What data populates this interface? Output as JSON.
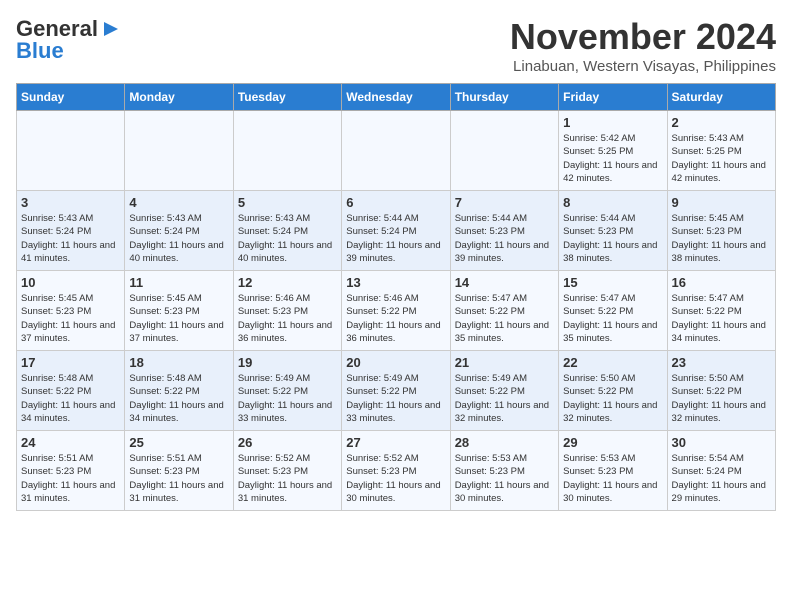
{
  "logo": {
    "text1": "General",
    "text2": "Blue"
  },
  "title": "November 2024",
  "location": "Linabuan, Western Visayas, Philippines",
  "weekdays": [
    "Sunday",
    "Monday",
    "Tuesday",
    "Wednesday",
    "Thursday",
    "Friday",
    "Saturday"
  ],
  "rows": [
    [
      {
        "day": "",
        "info": ""
      },
      {
        "day": "",
        "info": ""
      },
      {
        "day": "",
        "info": ""
      },
      {
        "day": "",
        "info": ""
      },
      {
        "day": "",
        "info": ""
      },
      {
        "day": "1",
        "info": "Sunrise: 5:42 AM\nSunset: 5:25 PM\nDaylight: 11 hours and 42 minutes."
      },
      {
        "day": "2",
        "info": "Sunrise: 5:43 AM\nSunset: 5:25 PM\nDaylight: 11 hours and 42 minutes."
      }
    ],
    [
      {
        "day": "3",
        "info": "Sunrise: 5:43 AM\nSunset: 5:24 PM\nDaylight: 11 hours and 41 minutes."
      },
      {
        "day": "4",
        "info": "Sunrise: 5:43 AM\nSunset: 5:24 PM\nDaylight: 11 hours and 40 minutes."
      },
      {
        "day": "5",
        "info": "Sunrise: 5:43 AM\nSunset: 5:24 PM\nDaylight: 11 hours and 40 minutes."
      },
      {
        "day": "6",
        "info": "Sunrise: 5:44 AM\nSunset: 5:24 PM\nDaylight: 11 hours and 39 minutes."
      },
      {
        "day": "7",
        "info": "Sunrise: 5:44 AM\nSunset: 5:23 PM\nDaylight: 11 hours and 39 minutes."
      },
      {
        "day": "8",
        "info": "Sunrise: 5:44 AM\nSunset: 5:23 PM\nDaylight: 11 hours and 38 minutes."
      },
      {
        "day": "9",
        "info": "Sunrise: 5:45 AM\nSunset: 5:23 PM\nDaylight: 11 hours and 38 minutes."
      }
    ],
    [
      {
        "day": "10",
        "info": "Sunrise: 5:45 AM\nSunset: 5:23 PM\nDaylight: 11 hours and 37 minutes."
      },
      {
        "day": "11",
        "info": "Sunrise: 5:45 AM\nSunset: 5:23 PM\nDaylight: 11 hours and 37 minutes."
      },
      {
        "day": "12",
        "info": "Sunrise: 5:46 AM\nSunset: 5:23 PM\nDaylight: 11 hours and 36 minutes."
      },
      {
        "day": "13",
        "info": "Sunrise: 5:46 AM\nSunset: 5:22 PM\nDaylight: 11 hours and 36 minutes."
      },
      {
        "day": "14",
        "info": "Sunrise: 5:47 AM\nSunset: 5:22 PM\nDaylight: 11 hours and 35 minutes."
      },
      {
        "day": "15",
        "info": "Sunrise: 5:47 AM\nSunset: 5:22 PM\nDaylight: 11 hours and 35 minutes."
      },
      {
        "day": "16",
        "info": "Sunrise: 5:47 AM\nSunset: 5:22 PM\nDaylight: 11 hours and 34 minutes."
      }
    ],
    [
      {
        "day": "17",
        "info": "Sunrise: 5:48 AM\nSunset: 5:22 PM\nDaylight: 11 hours and 34 minutes."
      },
      {
        "day": "18",
        "info": "Sunrise: 5:48 AM\nSunset: 5:22 PM\nDaylight: 11 hours and 34 minutes."
      },
      {
        "day": "19",
        "info": "Sunrise: 5:49 AM\nSunset: 5:22 PM\nDaylight: 11 hours and 33 minutes."
      },
      {
        "day": "20",
        "info": "Sunrise: 5:49 AM\nSunset: 5:22 PM\nDaylight: 11 hours and 33 minutes."
      },
      {
        "day": "21",
        "info": "Sunrise: 5:49 AM\nSunset: 5:22 PM\nDaylight: 11 hours and 32 minutes."
      },
      {
        "day": "22",
        "info": "Sunrise: 5:50 AM\nSunset: 5:22 PM\nDaylight: 11 hours and 32 minutes."
      },
      {
        "day": "23",
        "info": "Sunrise: 5:50 AM\nSunset: 5:22 PM\nDaylight: 11 hours and 32 minutes."
      }
    ],
    [
      {
        "day": "24",
        "info": "Sunrise: 5:51 AM\nSunset: 5:23 PM\nDaylight: 11 hours and 31 minutes."
      },
      {
        "day": "25",
        "info": "Sunrise: 5:51 AM\nSunset: 5:23 PM\nDaylight: 11 hours and 31 minutes."
      },
      {
        "day": "26",
        "info": "Sunrise: 5:52 AM\nSunset: 5:23 PM\nDaylight: 11 hours and 31 minutes."
      },
      {
        "day": "27",
        "info": "Sunrise: 5:52 AM\nSunset: 5:23 PM\nDaylight: 11 hours and 30 minutes."
      },
      {
        "day": "28",
        "info": "Sunrise: 5:53 AM\nSunset: 5:23 PM\nDaylight: 11 hours and 30 minutes."
      },
      {
        "day": "29",
        "info": "Sunrise: 5:53 AM\nSunset: 5:23 PM\nDaylight: 11 hours and 30 minutes."
      },
      {
        "day": "30",
        "info": "Sunrise: 5:54 AM\nSunset: 5:24 PM\nDaylight: 11 hours and 29 minutes."
      }
    ]
  ]
}
